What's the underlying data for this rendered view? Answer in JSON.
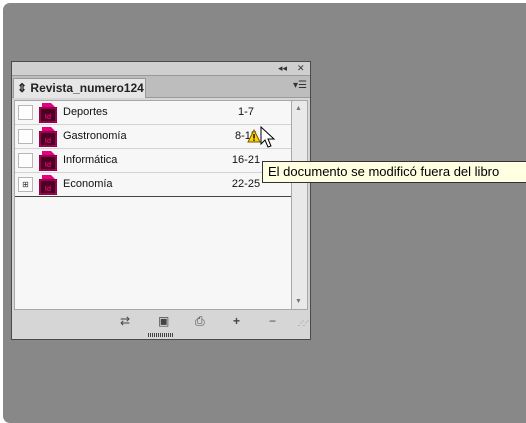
{
  "panel": {
    "title": "Revista_numero124",
    "collapse_icon": "double-chevron-left-icon",
    "close_icon": "close-icon",
    "menu_icon": "panel-menu-icon"
  },
  "documents": [
    {
      "name": "Deportes",
      "pages": "1-7",
      "sync": false,
      "warning": false
    },
    {
      "name": "Gastronomía",
      "pages": "8-15",
      "sync": false,
      "warning": true
    },
    {
      "name": "Informática",
      "pages": "16-21",
      "sync": false,
      "warning": false
    },
    {
      "name": "Economía",
      "pages": "22-25",
      "sync": true,
      "warning": false
    }
  ],
  "footer_icons": [
    "synchronize-icon",
    "save-icon",
    "print-icon",
    "add-document-icon",
    "remove-document-icon"
  ],
  "tooltip": "El documento se modificó fuera del libro",
  "colors": {
    "indesign_icon": "#e6007e",
    "indesign_icon_dark": "#49021f",
    "warning": "#ffd200",
    "tooltip_bg": "#ffffe1",
    "workspace": "#888888"
  }
}
